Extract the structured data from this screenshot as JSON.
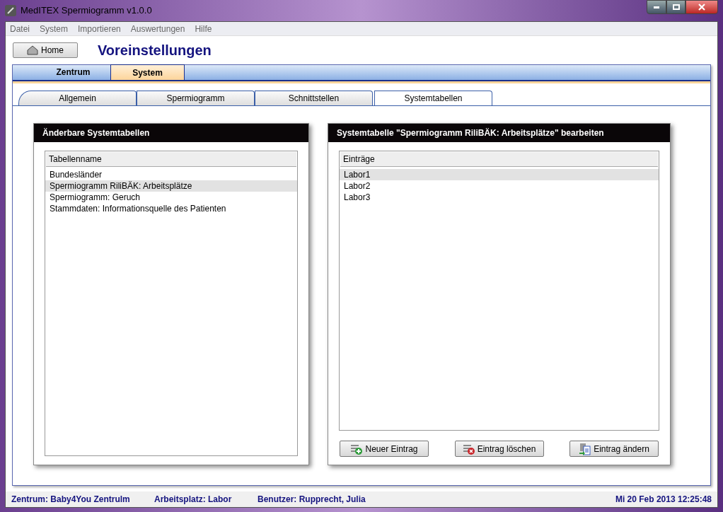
{
  "window": {
    "title": "MedITEX Spermiogramm v1.0.0"
  },
  "menu": [
    "Datei",
    "System",
    "Importieren",
    "Auswertungen",
    "Hilfe"
  ],
  "home_button": "Home",
  "page_title": "Voreinstellungen",
  "main_tabs": [
    {
      "label": "Zentrum",
      "selected": false
    },
    {
      "label": "System",
      "selected": true
    }
  ],
  "sub_tabs": [
    {
      "label": "Allgemein",
      "selected": false
    },
    {
      "label": "Spermiogramm",
      "selected": false
    },
    {
      "label": "Schnittstellen",
      "selected": false
    },
    {
      "label": "Systemtabellen",
      "selected": true
    }
  ],
  "left_panel": {
    "title": "Änderbare Systemtabellen",
    "column": "Tabellenname",
    "rows": [
      {
        "text": "Bundesländer",
        "selected": false
      },
      {
        "text": "Spermiogramm RiliBÄK: Arbeitsplätze",
        "selected": true
      },
      {
        "text": "Spermiogramm: Geruch",
        "selected": false
      },
      {
        "text": "Stammdaten: Informationsquelle des Patienten",
        "selected": false
      }
    ]
  },
  "right_panel": {
    "title": "Systemtabelle \"Spermiogramm RiliBÄK: Arbeitsplätze\" bearbeiten",
    "column": "Einträge",
    "rows": [
      {
        "text": "Labor1",
        "selected": true
      },
      {
        "text": "Labor2",
        "selected": false
      },
      {
        "text": "Labor3",
        "selected": false
      }
    ],
    "buttons": [
      {
        "label": "Neuer Eintrag",
        "kind": "add"
      },
      {
        "label": "Eintrag löschen",
        "kind": "delete"
      },
      {
        "label": "Eintrag ändern",
        "kind": "edit"
      }
    ]
  },
  "status_bar": {
    "left": [
      "Zentrum: Baby4You Zentrulm",
      "Arbeitsplatz: Labor",
      "Benutzer: Rupprecht, Julia"
    ],
    "right": "Mi 20 Feb 2013 12:25:48"
  }
}
